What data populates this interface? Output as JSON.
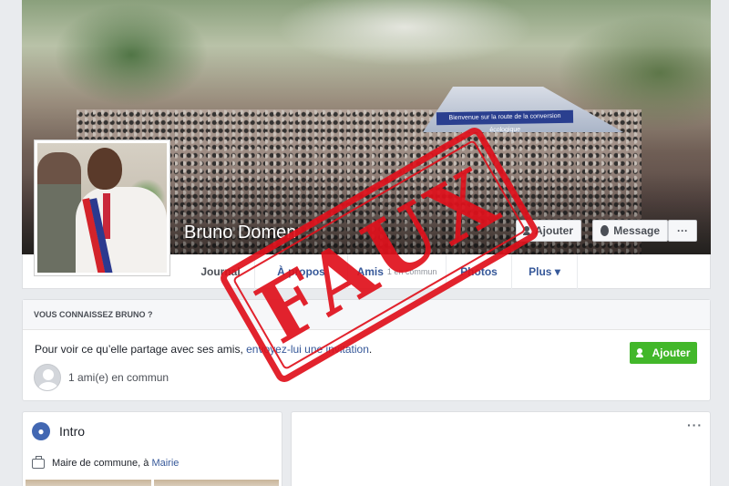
{
  "profile": {
    "name": "Bruno Domen"
  },
  "cover": {
    "banner_text": "Bienvenue sur la route de la conversion écologique"
  },
  "actions": {
    "add_label": "Ajouter",
    "message_label": "Message",
    "more_label": "···"
  },
  "nav": {
    "tabs": [
      {
        "label": "Journal"
      },
      {
        "label": "À propos"
      },
      {
        "label": "Amis",
        "sub": "1 en commun"
      },
      {
        "label": "Photos"
      },
      {
        "label": "Plus ▾"
      }
    ]
  },
  "know": {
    "title": "VOUS CONNAISSEZ BRUNO ?",
    "text_before": "Pour voir ce qu’elle partage avec ses amis, ",
    "link": "envoyez-lui une invitation",
    "text_after": ".",
    "button_label": "Ajouter",
    "mutual": "1 ami(e) en commun"
  },
  "intro": {
    "title": "Intro",
    "job_prefix": "Maire de commune, à ",
    "job_link": "Mairie"
  },
  "post": {
    "more_label": "···"
  },
  "stamp": {
    "text": "FAUX",
    "color": "#e0111c"
  },
  "colors": {
    "link": "#365899",
    "green_button": "#42b72a",
    "background": "#e9ebee"
  }
}
